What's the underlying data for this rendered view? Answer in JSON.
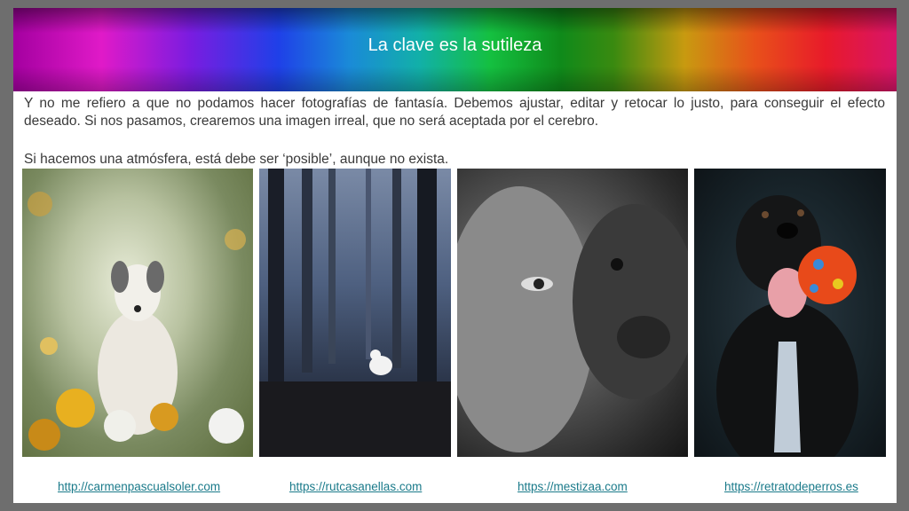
{
  "slide": {
    "title": "La clave es la sutileza",
    "paragraph1": "Y no me refiero a que no podamos hacer fotografías de fantasía. Debemos ajustar, editar y retocar lo justo, para conseguir el efecto deseado. Si nos pasamos, crearemos una imagen irreal, que no será aceptada por el cerebro.",
    "paragraph2": "Si hacemos una atmósfera, está debe ser ‘posible’, aunque no exista."
  },
  "photos": [
    {
      "icon": "dog-portrait-flowers-image"
    },
    {
      "icon": "forest-white-dog-image"
    },
    {
      "icon": "woman-and-dog-bw-image"
    },
    {
      "icon": "black-dog-tie-ball-image"
    }
  ],
  "links": [
    {
      "label": "http://carmenpascualsoler.com"
    },
    {
      "label": "https://rutcasanellas.com"
    },
    {
      "label": "https://mestizaa.com"
    },
    {
      "label": "https://retratodeperros.es"
    }
  ],
  "colors": {
    "link": "#1a7a8a",
    "text": "#3a3a3a",
    "title": "#ffffff"
  }
}
